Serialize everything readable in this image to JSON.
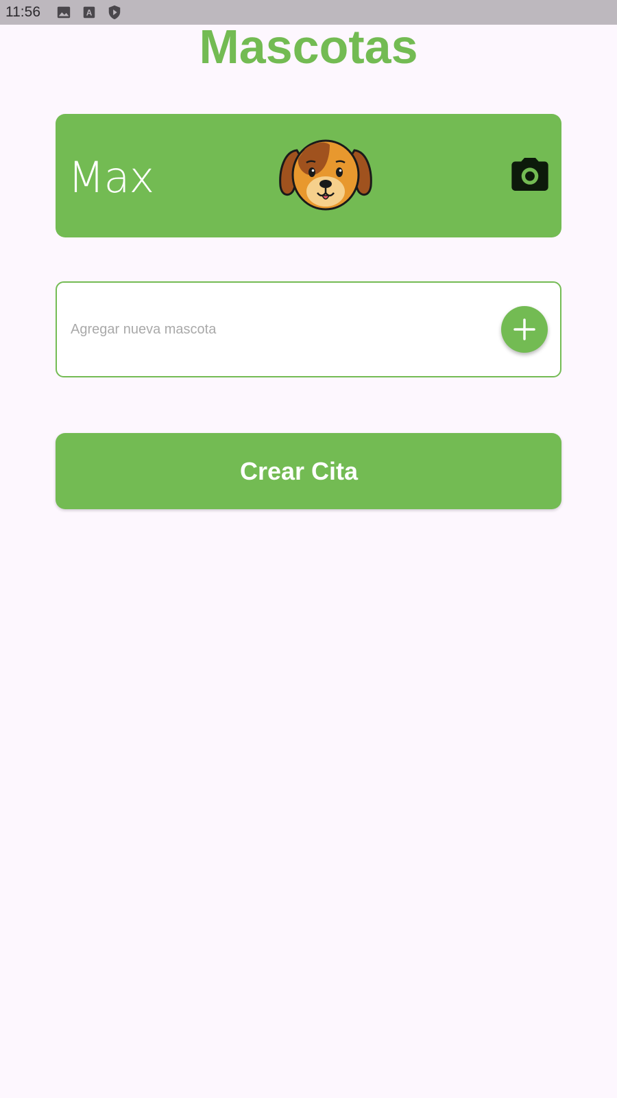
{
  "status_bar": {
    "time": "11:56",
    "icons": [
      "image-icon",
      "font-icon",
      "play-shield-icon"
    ]
  },
  "title": "Mascotas",
  "pet_card": {
    "name": "Max",
    "avatar": "dog-face-icon",
    "action_icon": "camera-icon"
  },
  "add_pet": {
    "placeholder": "Agregar nueva mascota",
    "value": "",
    "button_icon": "plus-icon"
  },
  "create_button": {
    "label": "Crear Cita"
  },
  "colors": {
    "accent": "#73bb53",
    "background": "#fdf7fe",
    "status_bar": "#bdb8be"
  }
}
